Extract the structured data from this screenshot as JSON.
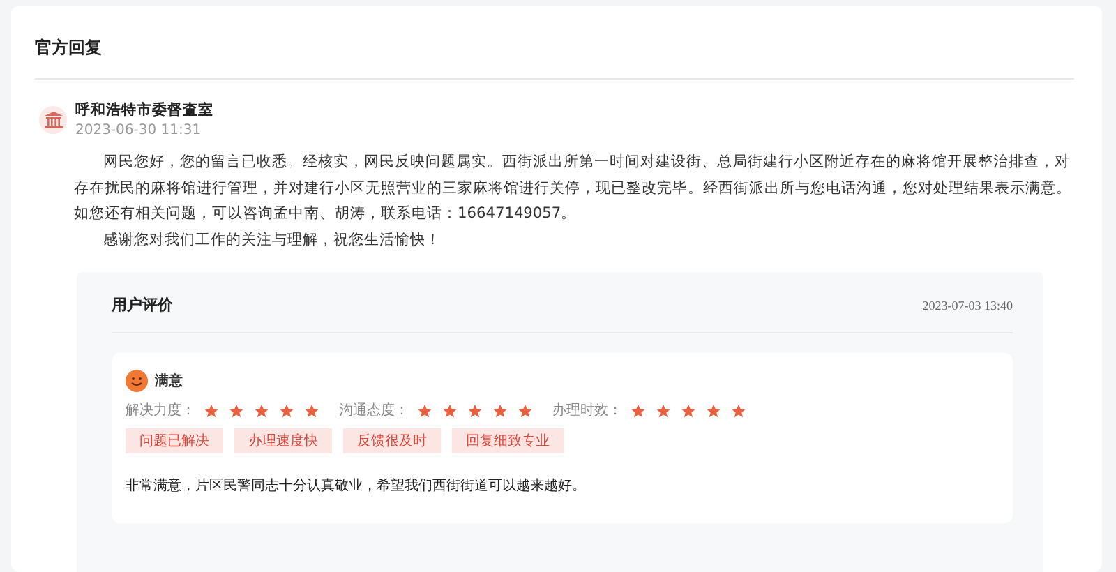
{
  "section_title": "官方回复",
  "reply": {
    "department": "呼和浩特市委督查室",
    "time": "2023-06-30 11:31",
    "paragraphs": [
      "网民您好，您的留言已收悉。经核实，网民反映问题属实。西街派出所第一时间对建设街、总局街建行小区附近存在的麻将馆开展整治排查，对存在扰民的麻将馆进行管理，并对建行小区无照营业的三家麻将馆进行关停，现已整改完毕。经西街派出所与您电话沟通，您对处理结果表示满意。如您还有相关问题，可以咨询孟中南、胡涛，联系电话：16647149057。",
      "感谢您对我们工作的关注与理解，祝您生活愉快！"
    ]
  },
  "evaluation": {
    "title": "用户评价",
    "time": "2023-07-03 13:40",
    "verdict": "满意",
    "ratings": [
      {
        "label": "解决力度：",
        "stars": 5
      },
      {
        "label": "沟通态度：",
        "stars": 5
      },
      {
        "label": "办理时效：",
        "stars": 5
      }
    ],
    "tags": [
      "问题已解决",
      "办理速度快",
      "反馈很及时",
      "回复细致专业"
    ],
    "comment": "非常满意，片区民警同志十分认真敬业，希望我们西街街道可以越来越好。"
  }
}
